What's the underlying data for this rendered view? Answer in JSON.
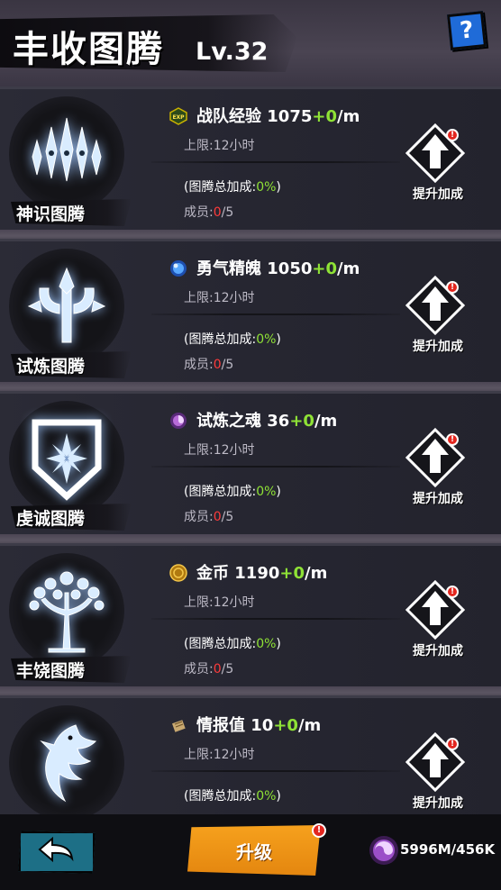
{
  "header": {
    "title": "丰收图腾",
    "level": "Lv.32",
    "help_label": "?"
  },
  "rows": [
    {
      "totem_name": "神识图腾",
      "resource_name": "战队经验",
      "resource_value": "1075",
      "rate_plus": "+0",
      "rate_unit": "/m",
      "limit_label": "上限:12小时",
      "bonus_prefix": "(图腾总加成:",
      "bonus_value": "0%",
      "bonus_suffix": ")",
      "members_label": "成员:",
      "members_current": "0",
      "members_total": "/5",
      "upgrade_label": "提升加成",
      "alert": "!",
      "resource_icon": "exp-icon",
      "totem_icon": "crown-icon"
    },
    {
      "totem_name": "试炼图腾",
      "resource_name": "勇气精魄",
      "resource_value": "1050",
      "rate_plus": "+0",
      "rate_unit": "/m",
      "limit_label": "上限:12小时",
      "bonus_prefix": "(图腾总加成:",
      "bonus_value": "0%",
      "bonus_suffix": ")",
      "members_label": "成员:",
      "members_current": "0",
      "members_total": "/5",
      "upgrade_label": "提升加成",
      "alert": "!",
      "resource_icon": "orb-icon",
      "totem_icon": "trident-icon"
    },
    {
      "totem_name": "虔诚图腾",
      "resource_name": "试炼之魂",
      "resource_value": "36",
      "rate_plus": "+0",
      "rate_unit": "/m",
      "limit_label": "上限:12小时",
      "bonus_prefix": "(图腾总加成:",
      "bonus_value": "0%",
      "bonus_suffix": ")",
      "members_label": "成员:",
      "members_current": "0",
      "members_total": "/5",
      "upgrade_label": "提升加成",
      "alert": "!",
      "resource_icon": "soul-icon",
      "totem_icon": "shield-icon"
    },
    {
      "totem_name": "丰饶图腾",
      "resource_name": "金币",
      "resource_value": "1190",
      "rate_plus": "+0",
      "rate_unit": "/m",
      "limit_label": "上限:12小时",
      "bonus_prefix": "(图腾总加成:",
      "bonus_value": "0%",
      "bonus_suffix": ")",
      "members_label": "成员:",
      "members_current": "0",
      "members_total": "/5",
      "upgrade_label": "提升加成",
      "alert": "!",
      "resource_icon": "coin-icon",
      "totem_icon": "tree-icon"
    },
    {
      "totem_name": "",
      "resource_name": "情报值",
      "resource_value": "10",
      "rate_plus": "+0",
      "rate_unit": "/m",
      "limit_label": "上限:12小时",
      "bonus_prefix": "(图腾总加成:",
      "bonus_value": "0%",
      "bonus_suffix": ")",
      "members_label": "",
      "members_current": "",
      "members_total": "",
      "upgrade_label": "提升加成",
      "alert": "!",
      "resource_icon": "scroll-icon",
      "totem_icon": "eagle-icon"
    }
  ],
  "footer": {
    "back_icon": "return-arrow-icon",
    "upgrade_label": "升级",
    "upgrade_alert": "!",
    "soul_amount": "5996M/456K",
    "soul_icon": "soul-icon"
  },
  "colors": {
    "green": "#8fe236",
    "red": "#ff3b3b",
    "orange": "#f6a11d",
    "teal": "#1d6f86",
    "help_blue": "#1f6bd8"
  }
}
